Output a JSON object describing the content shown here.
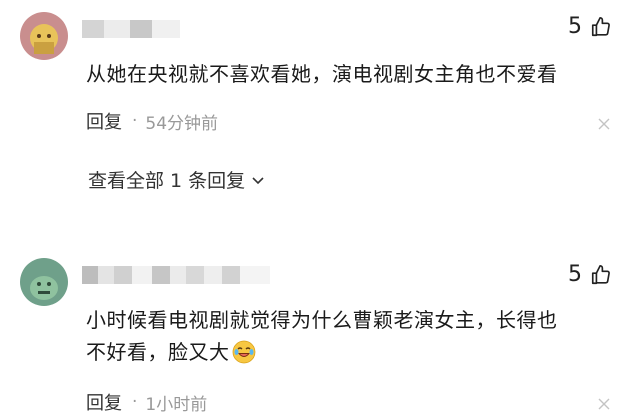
{
  "comments": [
    {
      "likes": "5",
      "text": "从她在央视就不喜欢看她，演电视剧女主角也不爱看",
      "reply_label": "回复",
      "time": "54分钟前",
      "view_all_label": "查看全部 1 条回复"
    },
    {
      "likes": "5",
      "text_line1": "小时候看电视剧就觉得为什么曹颖老演女主，长得也",
      "text_line2": "不好看，脸又大",
      "reply_label": "回复",
      "time": "1小时前"
    }
  ],
  "colors": {
    "text": "#1a1a1a",
    "meta": "#999999",
    "avatar1_bg": "#c98e8e",
    "avatar2_bg": "#6fa08a"
  },
  "icons": [
    "thumbs-up-icon",
    "close-icon",
    "chevron-down-icon",
    "laughing-emoji-icon"
  ]
}
